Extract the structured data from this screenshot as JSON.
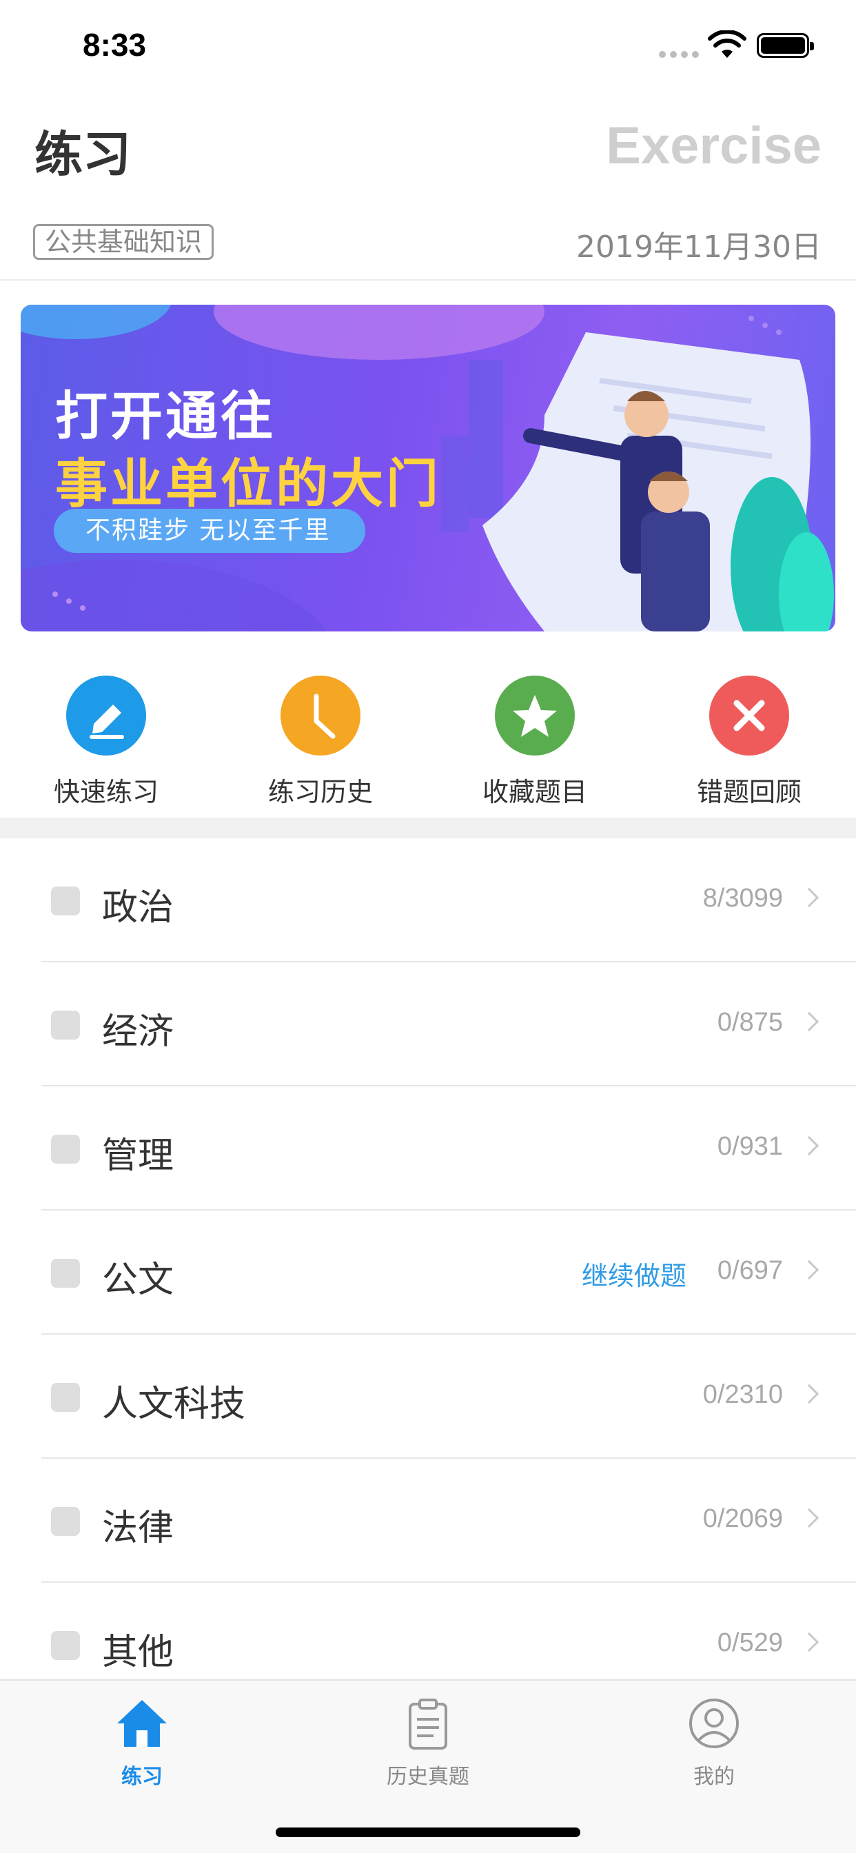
{
  "status_bar": {
    "time": "8:33"
  },
  "header": {
    "title": "练习",
    "title_en": "Exercise",
    "subject_tag": "公共基础知识",
    "date": "2019年11月30日"
  },
  "banner": {
    "line1": "打开通往",
    "line2": "事业单位的大门",
    "slogan": "不积跬步 无以至千里"
  },
  "quick_actions": [
    {
      "label": "快速练习",
      "icon": "pencil-icon",
      "color": "#1e9be8"
    },
    {
      "label": "练习历史",
      "icon": "clock-icon",
      "color": "#f5a623"
    },
    {
      "label": "收藏题目",
      "icon": "star-icon",
      "color": "#5aad4e"
    },
    {
      "label": "错题回顾",
      "icon": "close-icon",
      "color": "#ef5b5b"
    }
  ],
  "categories": [
    {
      "name": "政治",
      "count": "8/3099",
      "continue": ""
    },
    {
      "name": "经济",
      "count": "0/875",
      "continue": ""
    },
    {
      "name": "管理",
      "count": "0/931",
      "continue": ""
    },
    {
      "name": "公文",
      "count": "0/697",
      "continue": "继续做题"
    },
    {
      "name": "人文科技",
      "count": "0/2310",
      "continue": ""
    },
    {
      "name": "法律",
      "count": "0/2069",
      "continue": ""
    },
    {
      "name": "其他",
      "count": "0/529",
      "continue": ""
    }
  ],
  "tab_bar": {
    "tabs": [
      {
        "label": "练习",
        "icon": "home-icon",
        "active": true
      },
      {
        "label": "历史真题",
        "icon": "clipboard-icon",
        "active": false
      },
      {
        "label": "我的",
        "icon": "user-icon",
        "active": false
      }
    ]
  },
  "colors": {
    "accent": "#1a8ce8",
    "banner_yellow": "#ffd23f"
  }
}
